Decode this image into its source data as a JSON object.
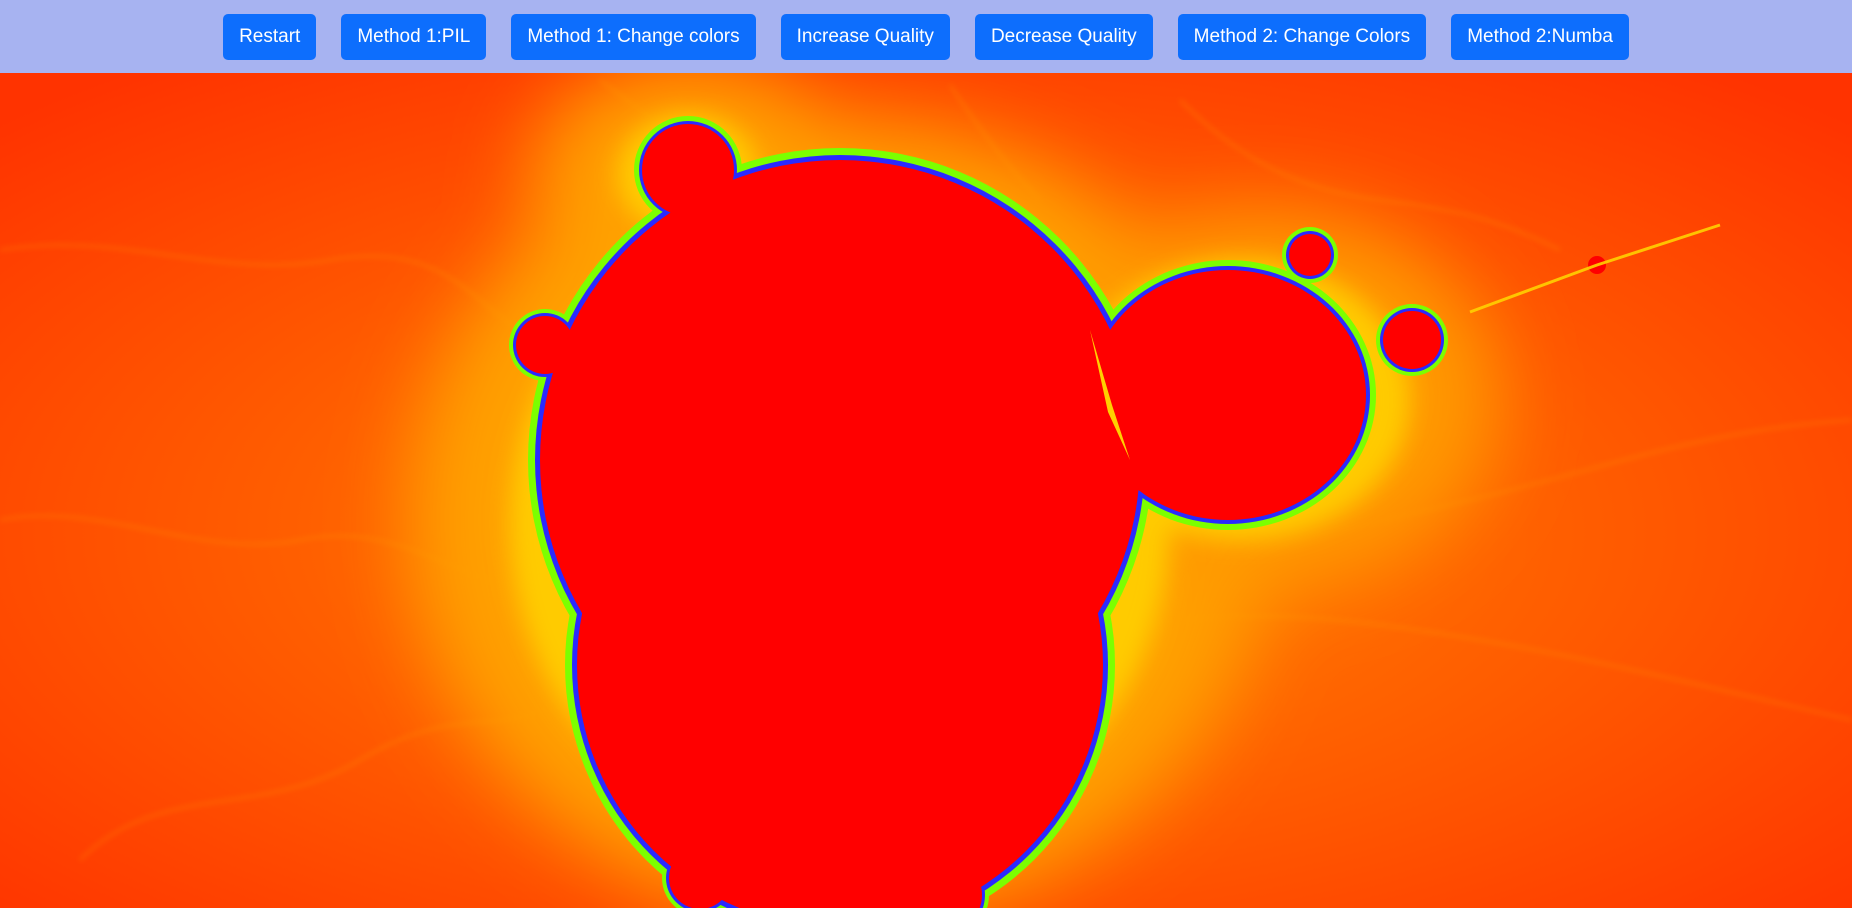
{
  "toolbar": {
    "buttons": [
      {
        "id": "restart",
        "label": "Restart"
      },
      {
        "id": "method1-pil",
        "label": "Method 1:PIL"
      },
      {
        "id": "method1-colors",
        "label": "Method 1: Change colors"
      },
      {
        "id": "increase-quality",
        "label": "Increase Quality"
      },
      {
        "id": "decrease-quality",
        "label": "Decrease Quality"
      },
      {
        "id": "method2-colors",
        "label": "Method 2: Change Colors"
      },
      {
        "id": "method2-numba",
        "label": "Method 2:Numba"
      }
    ],
    "colors": {
      "bar_background": "#a7b3f1",
      "button_background": "#0d6efd",
      "button_text": "#ffffff"
    }
  },
  "fractal": {
    "kind": "mandelbrot-set-zoom",
    "colors": {
      "set_interior": "#ff0000",
      "outer_background": "#ff3300",
      "glow_orange": "#ff8c00",
      "glow_yellow": "#ffe000",
      "edge_green": "#7cff00",
      "edge_blue": "#2a2aff"
    }
  }
}
